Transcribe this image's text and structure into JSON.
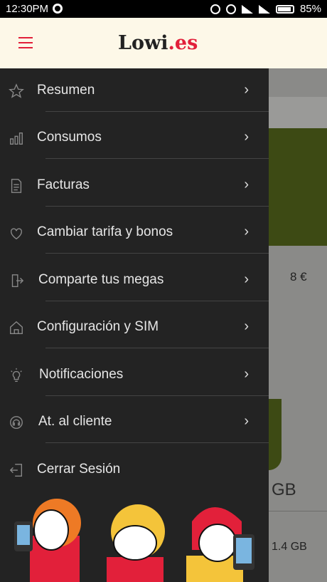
{
  "status_bar": {
    "time": "12:30PM",
    "battery": "85%"
  },
  "app_bar": {
    "logo_main": "Lowi",
    "logo_accent": ".es"
  },
  "background": {
    "price": "8 €",
    "gb_large": "GB",
    "gb_small": "1.4 GB"
  },
  "menu": {
    "items": [
      {
        "label": "Resumen",
        "icon": "star-icon"
      },
      {
        "label": "Consumos",
        "icon": "bar-chart-icon"
      },
      {
        "label": "Facturas",
        "icon": "document-icon"
      },
      {
        "label": "Cambiar tarifa y bonos",
        "icon": "heart-icon"
      },
      {
        "label": "Comparte tus megas",
        "icon": "share-icon"
      },
      {
        "label": "Configuración y SIM",
        "icon": "home-icon"
      },
      {
        "label": "Notificaciones",
        "icon": "lightbulb-icon"
      },
      {
        "label": "At. al cliente",
        "icon": "headset-icon"
      },
      {
        "label": "Cerrar Sesión",
        "icon": "logout-icon"
      }
    ]
  },
  "colors": {
    "accent": "#e2203a",
    "drawer": "#232323",
    "appbar": "#fdf8e8"
  }
}
